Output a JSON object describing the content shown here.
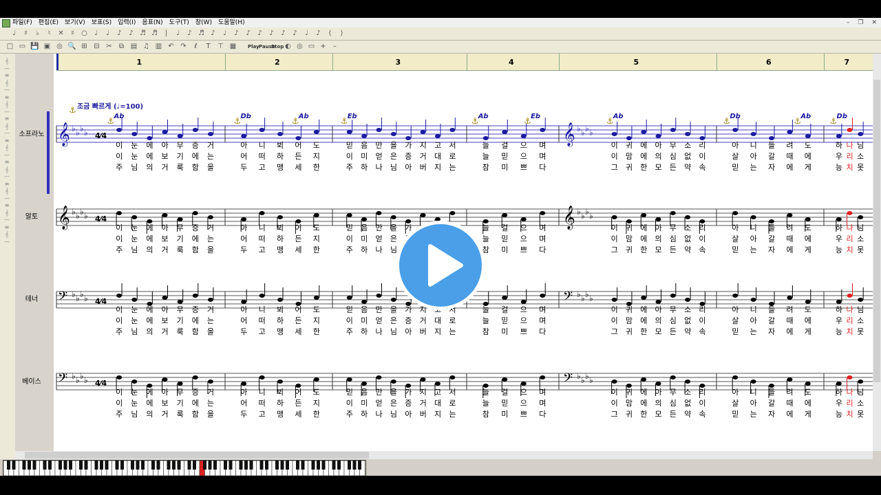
{
  "menubar": {
    "items": [
      "파일(F)",
      "편집(E)",
      "보기(V)",
      "보표(S)",
      "입력(I)",
      "음표(N)",
      "도구(T)",
      "창(W)",
      "도움말(H)"
    ]
  },
  "toolbar": {
    "play_label": "Play",
    "pause_label": "Pause",
    "stop_label": "Stop"
  },
  "ruler": {
    "measures": [
      "1",
      "2",
      "3",
      "4",
      "5",
      "6",
      "7"
    ]
  },
  "tempo": {
    "text": "조금 빠르게 (",
    "value": "=100)"
  },
  "tracks": [
    {
      "name": "소프라노",
      "clef": "treble"
    },
    {
      "name": "알토",
      "clef": "treble"
    },
    {
      "name": "테너",
      "clef": "bass"
    },
    {
      "name": "베이스",
      "clef": "bass"
    }
  ],
  "chords": [
    "Ab",
    "Db",
    "Ab",
    "Eb",
    "Ab",
    "Eb",
    "Ab",
    "Db",
    "Ab",
    "Db"
  ],
  "time_signature": "4/4",
  "lyrics": {
    "verse1": [
      [
        "이",
        "눈",
        "에",
        "아",
        "무",
        "증",
        "거"
      ],
      [
        "아",
        "니",
        "뵈",
        "어",
        "도"
      ],
      [
        "믿",
        "음",
        "만",
        "을",
        "가",
        "지",
        "고",
        "서"
      ],
      [
        "늘",
        "걸",
        "으",
        "며"
      ],
      [
        "이",
        "귀",
        "에",
        "아",
        "무",
        "소",
        "리"
      ],
      [
        "아",
        "니",
        "들",
        "려",
        "도"
      ],
      [
        "하",
        "나",
        "님"
      ]
    ],
    "verse2": [
      [
        "이",
        "눈",
        "에",
        "보",
        "기",
        "에",
        "는"
      ],
      [
        "어",
        "떠",
        "하",
        "든",
        "지"
      ],
      [
        "이",
        "미",
        "얻",
        "은",
        "증",
        "거",
        "대",
        "로"
      ],
      [
        "늘",
        "믿",
        "으",
        "며"
      ],
      [
        "이",
        "맘",
        "에",
        "의",
        "심",
        "없",
        "이"
      ],
      [
        "살",
        "아",
        "갈",
        "때",
        "에"
      ],
      [
        "우",
        "리",
        "소"
      ]
    ],
    "verse3_soprano": [
      [
        "주",
        "님",
        "의",
        "거",
        "룩",
        "함",
        "을"
      ],
      [
        "두",
        "고",
        "맹",
        "세",
        "한"
      ],
      [
        "주",
        "하",
        "나",
        "님",
        "아",
        "버",
        "지",
        "는"
      ],
      [
        "참",
        "미",
        "쁘",
        "다"
      ],
      [
        "그",
        "귀",
        "한",
        "모",
        "든",
        "약",
        "속"
      ],
      [
        "믿",
        "는",
        "자",
        "에",
        "게"
      ],
      [
        "능",
        "치",
        "못"
      ]
    ],
    "verse3": [
      [
        "주",
        "님",
        "의",
        "거",
        "룩",
        "함",
        "을"
      ],
      [
        "두",
        "고",
        "맹",
        "세",
        "한"
      ],
      [
        "주",
        "하",
        "나",
        "님",
        "아",
        "버",
        "지",
        "는"
      ],
      [
        "참",
        "미",
        "쁘",
        "다"
      ],
      [
        "그",
        "귀",
        "한",
        "모",
        "든",
        "약",
        "속"
      ],
      [
        "믿",
        "는",
        "자",
        "에",
        "게"
      ],
      [
        "능",
        "치",
        "못"
      ]
    ]
  },
  "colors": {
    "note": "#1a1aa0",
    "staff": "#4040c0",
    "ruler_bg": "#f2ecc8",
    "active_note": "#e02020",
    "play_button": "#4a9fe8"
  }
}
